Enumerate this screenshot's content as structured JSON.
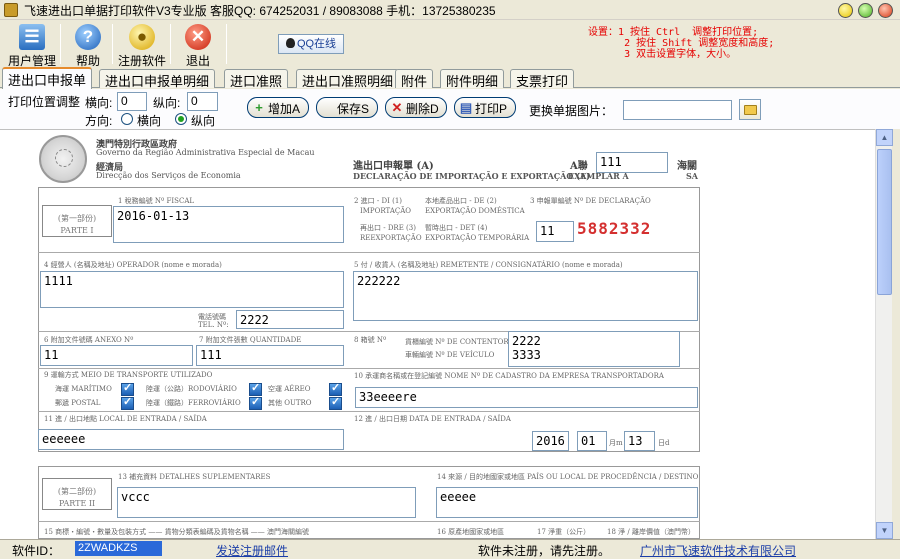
{
  "window": {
    "title": "飞速进出口单据打印软件V3专业版 客服QQ: 674252031 / 89083088 手机：13725380235"
  },
  "toolbar": {
    "user_mgmt": "用户管理",
    "help": "帮助",
    "register": "注册软件",
    "exit": "退出",
    "qq_online": "QQ在线"
  },
  "settings_note": {
    "line1": "设置：1 按住 Ctrl  调整打印位置;",
    "line2": "      2 按住 Shift 调整宽度和高度;",
    "line3": "      3 双击设置字体，大小。"
  },
  "tabs": [
    "进出口申报单",
    "进出口申报单明细",
    "进口准照",
    "进出口准照明细",
    "附件",
    "附件明细",
    "支票打印"
  ],
  "controls": {
    "position_label": "打印位置调整",
    "horizontal_label": "横向:",
    "horizontal_value": "0",
    "vertical_label": "纵向:",
    "vertical_value": "0",
    "direction_label": "方向:",
    "dir_horizontal": "横向",
    "dir_vertical": "纵向",
    "add_btn": "增加A",
    "save_btn": "保存S",
    "delete_btn": "删除D",
    "print_btn": "打印P",
    "replace_image_label": "更换单据图片："
  },
  "document": {
    "gov_line1": "澳門特別行政區政府",
    "gov_line2": "Governo da Região Administrativa Especial de Macau",
    "gov_line3": "經濟局",
    "gov_line4": "Direcção dos Serviços de Economia",
    "form_title_cn": "進出口申報單 (A)",
    "form_title_pt": "DECLARAÇÃO DE IMPORTAÇÃO E EXPORTAÇÃO (A)",
    "copy_label": "A聯",
    "copy_label_pt": "EXEMPLAR A",
    "customs_label": "海關",
    "customs_label_pt": "SA",
    "part1": "(第一部份)",
    "part1_pt": "PARTE I",
    "part2": "(第二部份)",
    "part2_pt": "PARTE II",
    "box1_label": "1 稅務編號 Nº FISCAL",
    "box2a": "2 進口 - DI (1)",
    "box2b": "IMPORTAÇÃO",
    "box2c": "本地產品出口 - DE (2)",
    "box2d": "EXPORTAÇÃO DOMÉSTICA",
    "box2e": "再出口 - DRE (3)",
    "box2f": "REEXPORTAÇÃO",
    "box2g": "暫時出口 - DET (4)",
    "box2h": "EXPORTAÇÃO TEMPORÁRIA",
    "box3_label": "3 申報單編號 Nº DE DECLARAÇÃO",
    "box4_label": "4 經營人 (名稱及地址) OPERADOR (nome e morada)",
    "box5_label": "5 付 / 收貨人 (名稱及地址) REMETENTE / CONSIGNATÁRIO (nome e morada)",
    "tel_label": "電話號碼",
    "tel_label_pt": "TEL. Nº:",
    "box6_label": "6 附加文件號碼 ANEXO Nº",
    "box7_label": "7 附加文件張數 QUANTIDADE",
    "box8_label": "8 箱號 Nº",
    "container_label": "貨櫃編號 Nº DE CONTENTOR",
    "vehicle_label": "車輛編號 Nº DE VEÍCULO",
    "box9_label": "9 運輸方式 MEIO DE TRANSPORTE UTILIZADO",
    "t_maritimo": "海運 MARÍTIMO",
    "t_rodoviario": "陸運（公路）RODOVIÁRIO",
    "t_aereo": "空運 AÉREO",
    "t_postal": "郵遞 POSTAL",
    "t_ferroviario": "陸運（鐵路）FERROVIÁRIO",
    "t_outro": "其他 OUTRO",
    "box10_label": "10 承運商名稱或在登記編號 NOME Nº DE CADASTRO DA EMPRESA TRANSPORTADORA",
    "box11_label": "11 進 / 出口地點 LOCAL DE ENTRADA / SAÍDA",
    "box12_label": "12 進 / 出口日期 DATA DE ENTRADA / SAÍDA",
    "month_label": "月m",
    "day_label": "日d",
    "box13_label": "13 補充資料 DETALHES SUPLEMENTARES",
    "box14_label": "14 來源 / 目的地國家或地區 PAÍS OU LOCAL DE PROCEDÊNCIA / DESTINO",
    "box15_label": "15 商標・編號・數量及包裝方式 —— 貨物分類表編碼及貨物名稱 —— 澳門海關編號",
    "box16_label": "16 原產地國家或地區",
    "box17_label": "17 淨重（公斤）",
    "box18_label": "18 淨 / 離岸價值（澳門幣）"
  },
  "fields": {
    "copy_no": "111",
    "fiscal_no": "2016-01-13",
    "declaration_prefix": "11",
    "declaration_no": "5882332",
    "operator": "1111",
    "consignee": "222222",
    "tel": "2222",
    "annex_no": "11",
    "quantity": "111",
    "container_no": "2222",
    "vehicle_no": "3333",
    "carrier": "33eeeere",
    "entry_place": "eeeeee",
    "date_year": "2016",
    "date_month": "01",
    "date_day": "13",
    "supplementary": "vccc",
    "origin": "eeeee"
  },
  "transport_checked": {
    "maritimo": true,
    "rodoviario": true,
    "aereo": true,
    "postal": true,
    "ferroviario": true,
    "outro": true
  },
  "status": {
    "software_id_label": "软件ID：",
    "software_id": "2ZWADKZS",
    "send_register": "发送注册邮件",
    "unregistered": "软件未注册，请先注册。",
    "company": "广州市飞速软件技术有限公司"
  },
  "colors": {
    "note_red": "#e60000",
    "declaration_red": "#d42f2f",
    "tab_active_border": "#e68b2c",
    "status_id_bg": "#2a69d9",
    "link_blue": "#1b3ea8"
  }
}
